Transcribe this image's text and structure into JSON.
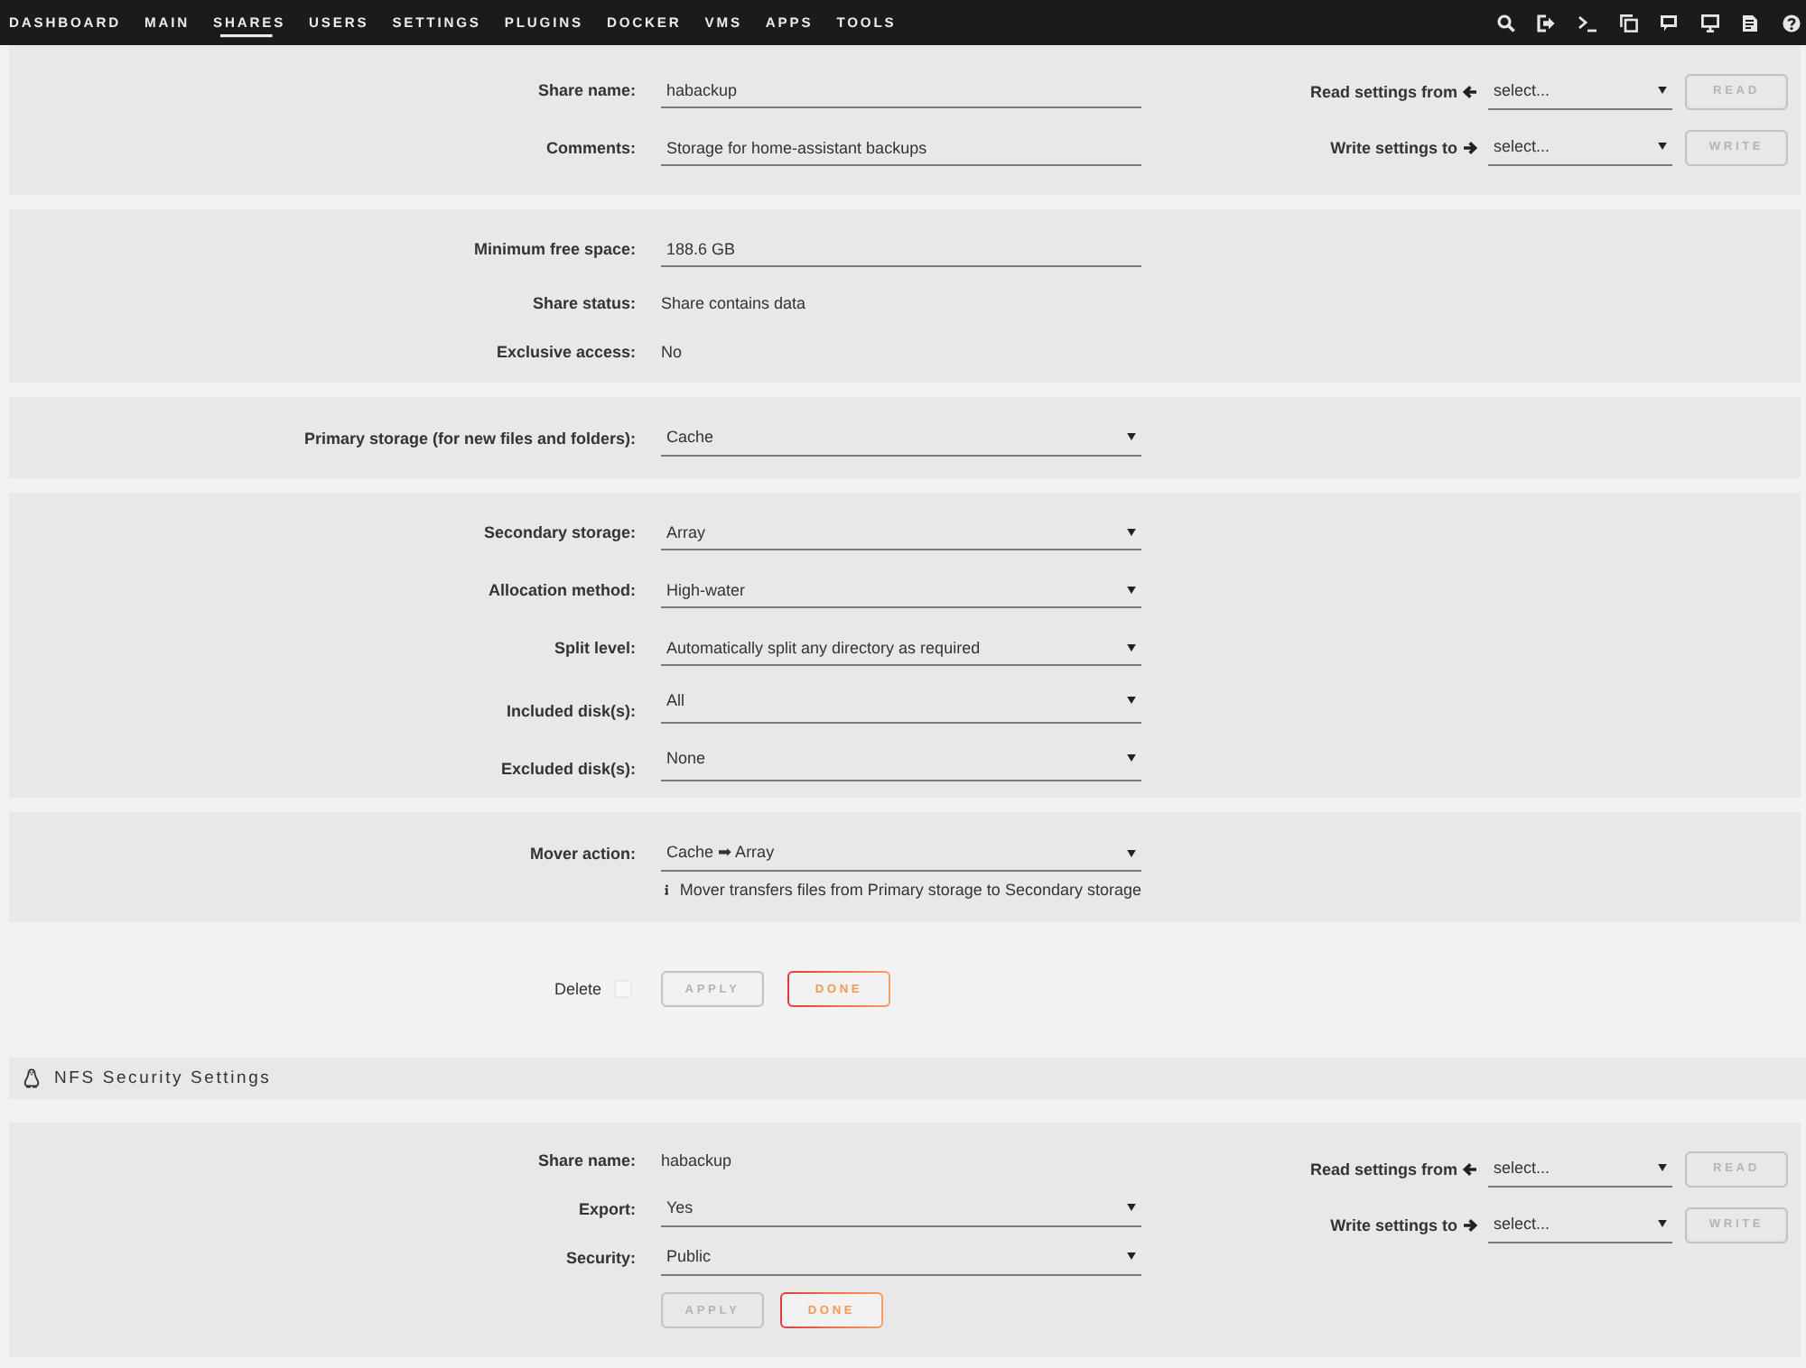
{
  "nav": {
    "tabs": [
      {
        "label": "DASHBOARD",
        "selected": false
      },
      {
        "label": "MAIN",
        "selected": false
      },
      {
        "label": "SHARES",
        "selected": true
      },
      {
        "label": "USERS",
        "selected": false
      },
      {
        "label": "SETTINGS",
        "selected": false
      },
      {
        "label": "PLUGINS",
        "selected": false
      },
      {
        "label": "DOCKER",
        "selected": false
      },
      {
        "label": "VMS",
        "selected": false
      },
      {
        "label": "APPS",
        "selected": false
      },
      {
        "label": "TOOLS",
        "selected": false
      }
    ]
  },
  "share_panels": [
    {
      "rows": [
        {
          "kind": "input",
          "label": "Share name:",
          "value": "habackup"
        },
        {
          "kind": "input",
          "label": "Comments:",
          "value": "Storage for home-assistant backups"
        }
      ],
      "copy_settings": [
        {
          "kind": "read",
          "label": "Read settings from",
          "value": "select...",
          "button": {
            "label": "READ",
            "disabled": true
          }
        },
        {
          "kind": "write",
          "label": "Write settings to",
          "value": "select...",
          "button": {
            "label": "WRITE",
            "disabled": true
          }
        }
      ]
    },
    {
      "rows": [
        {
          "kind": "input",
          "label": "Minimum free space:",
          "value": "188.6 GB"
        },
        {
          "kind": "text",
          "label": "Share status:",
          "value": "Share contains data"
        },
        {
          "kind": "text",
          "label": "Exclusive access:",
          "value": "No"
        }
      ]
    },
    {
      "rows": [
        {
          "kind": "select",
          "label": "Primary storage (for new files and folders):",
          "value": "Cache"
        }
      ]
    },
    {
      "rows": [
        {
          "kind": "select",
          "label": "Secondary storage:",
          "value": "Array"
        },
        {
          "kind": "select",
          "label": "Allocation method:",
          "value": "High-water"
        },
        {
          "kind": "select",
          "label": "Split level:",
          "value": "Automatically split any directory as required"
        },
        {
          "kind": "multiselect",
          "label": "Included disk(s):",
          "value": "All"
        },
        {
          "kind": "multiselect",
          "label": "Excluded disk(s):",
          "value": "None"
        }
      ]
    },
    {
      "rows": [
        {
          "kind": "select",
          "label": "Mover action:",
          "value": "Cache ➡ Array",
          "note": "Mover transfers files from Primary storage to Secondary storage"
        }
      ]
    }
  ],
  "share_actions": {
    "delete": {
      "label": "Delete",
      "checked": false
    },
    "buttons": [
      {
        "label": "APPLY",
        "disabled": true
      },
      {
        "label": "DONE",
        "disabled": false
      }
    ]
  },
  "nfs_section": {
    "title": "NFS Security Settings",
    "rows": [
      {
        "kind": "text",
        "label": "Share name:",
        "value": "habackup"
      },
      {
        "kind": "select",
        "label": "Export:",
        "value": "Yes"
      },
      {
        "kind": "select",
        "label": "Security:",
        "value": "Public"
      }
    ],
    "buttons": [
      {
        "label": "APPLY",
        "disabled": true
      },
      {
        "label": "DONE",
        "disabled": false
      }
    ],
    "copy_settings": [
      {
        "kind": "read",
        "label": "Read settings from",
        "value": "select...",
        "button": {
          "label": "READ",
          "disabled": true
        }
      },
      {
        "kind": "write",
        "label": "Write settings to",
        "value": "select...",
        "button": {
          "label": "WRITE",
          "disabled": true
        }
      }
    ]
  }
}
